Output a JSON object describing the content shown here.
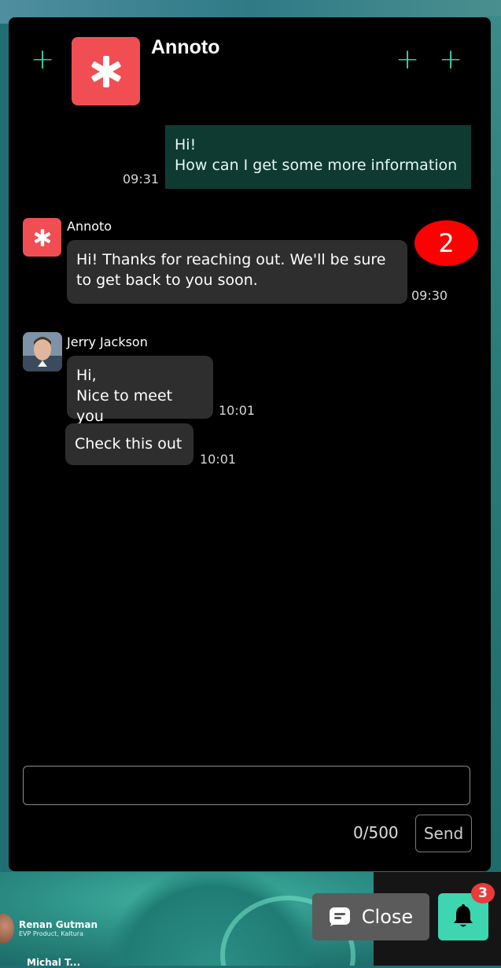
{
  "panel": {
    "title": "Annoto",
    "colors": {
      "accent": "#3ddbb4",
      "brand": "#f04e53",
      "outgoing_bubble": "#0e3a32",
      "incoming_bubble": "#2e2e2e"
    }
  },
  "messages": {
    "outgoing": {
      "line1": "Hi!",
      "line2": "How can I get  some more information",
      "time": "09:31"
    },
    "annoto": {
      "sender": "Annoto",
      "text": "Hi! Thanks for reaching out. We'll be sure to get back to you soon.",
      "time": "09:30"
    },
    "jerry": {
      "sender": "Jerry Jackson",
      "bubble1_line1": "Hi,",
      "bubble1_line2": "Nice to meet you",
      "time1": "10:01",
      "bubble2": "Check this out",
      "time2": "10:01"
    }
  },
  "annotation_badge": "2",
  "composer": {
    "value": "",
    "placeholder": "",
    "counter": "0/500",
    "send_label": "Send"
  },
  "controls": {
    "close_label": "Close",
    "notification_count": "3"
  },
  "video": {
    "speaker_name": "Renan Gutman",
    "speaker_role": "EVP Product, Kaltura",
    "speaker2_name": "Michal T..."
  }
}
